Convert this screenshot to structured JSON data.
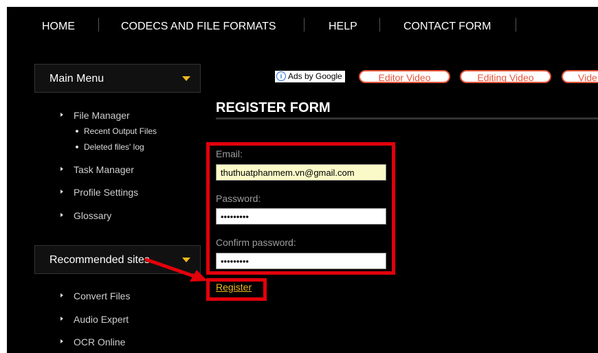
{
  "nav": {
    "items": [
      "HOME",
      "CODECS AND FILE FORMATS",
      "HELP",
      "CONTACT FORM"
    ]
  },
  "sidebar": {
    "main_menu_title": "Main Menu",
    "main_menu_items": {
      "file_manager": "File Manager",
      "recent_output_files": "Recent Output Files",
      "deleted_files_log": "Deleted files' log",
      "task_manager": "Task Manager",
      "profile_settings": "Profile Settings",
      "glossary": "Glossary"
    },
    "recommended_title": "Recommended sites",
    "recommended_items": [
      "Convert Files",
      "Audio Expert",
      "OCR Online"
    ]
  },
  "ads": {
    "ads_by": "Ads by Google",
    "links": [
      "Editor Video",
      "Editing Video",
      "Vide"
    ]
  },
  "form": {
    "title": "REGISTER FORM",
    "email_label": "Email:",
    "email_value": "thuthuatphanmem.vn@gmail.com",
    "password_label": "Password:",
    "password_value": "•••••••••",
    "confirm_label": "Confirm password:",
    "confirm_value": "•••••••••",
    "register_label": "Register"
  },
  "colors": {
    "highlight": "#e3000b",
    "accent": "#f0b91c",
    "ad_link": "#e8553a"
  }
}
